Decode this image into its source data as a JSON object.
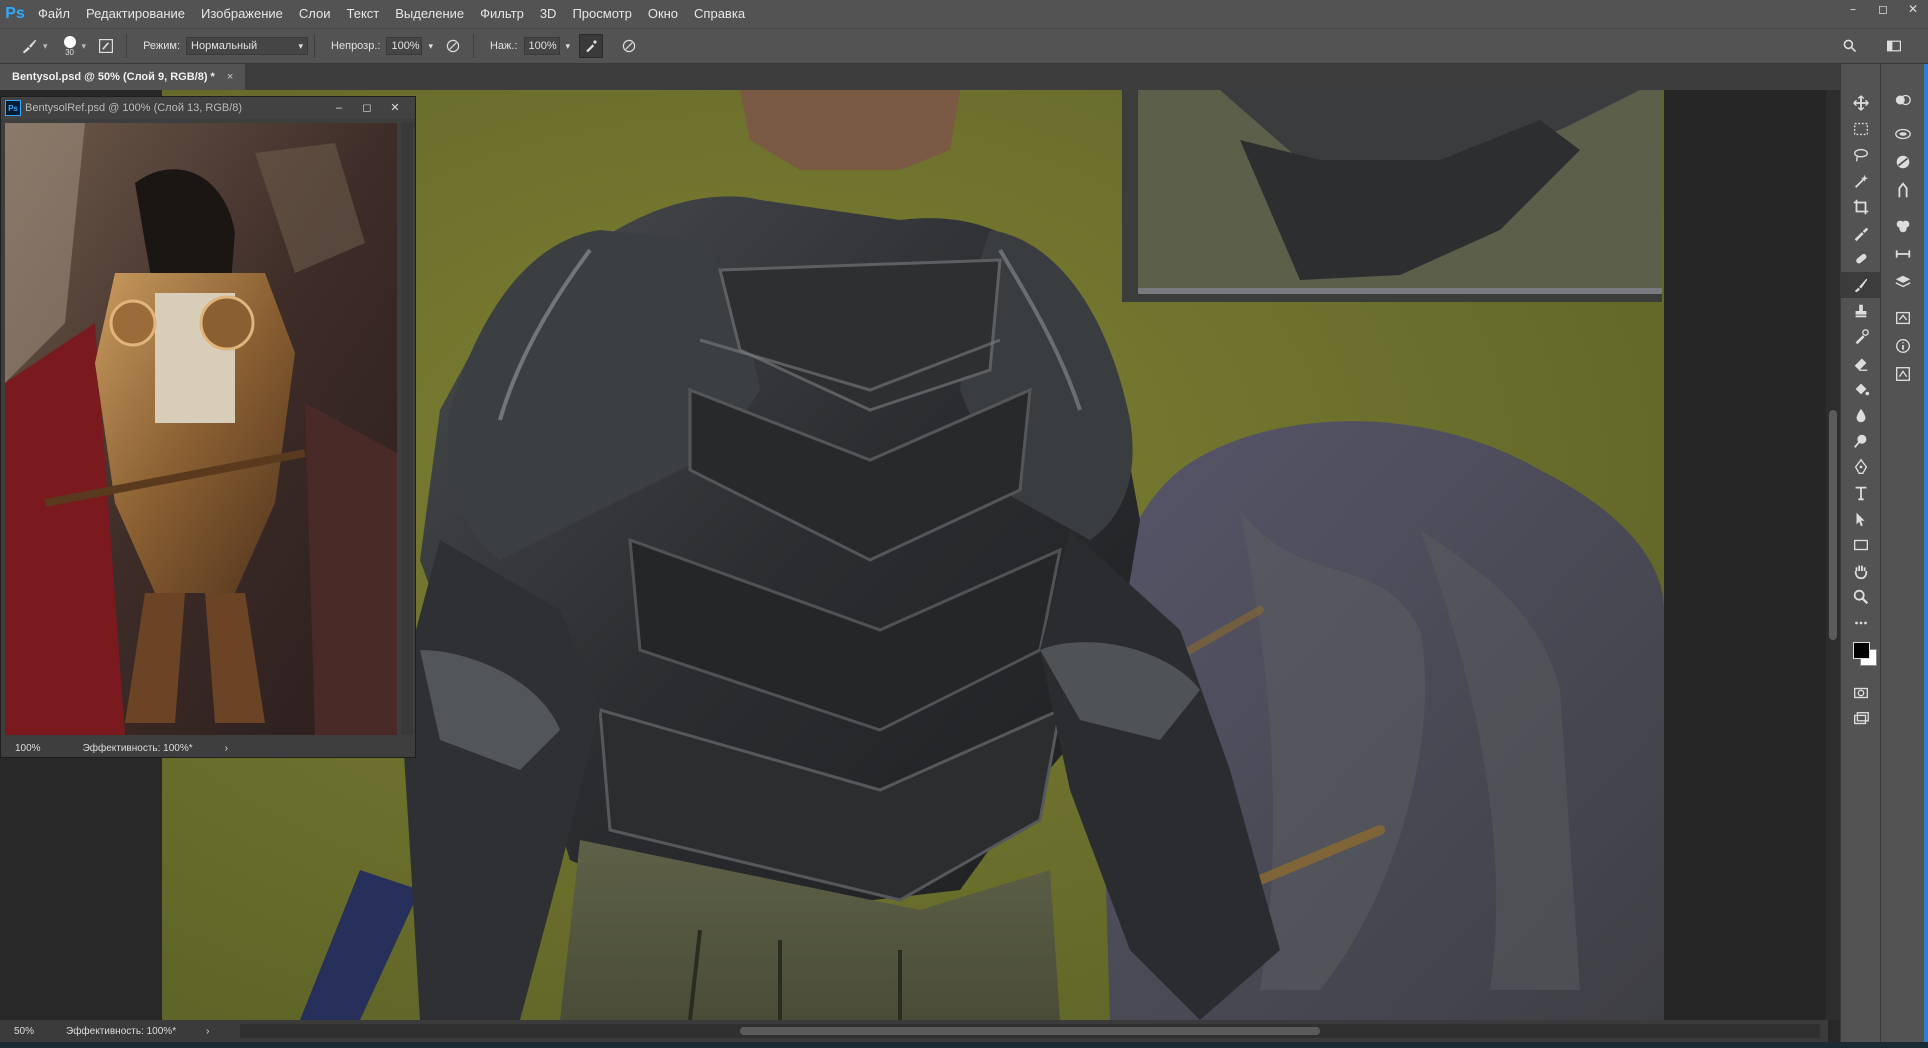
{
  "app": {
    "logo": "Ps"
  },
  "menu": [
    "Файл",
    "Редактирование",
    "Изображение",
    "Слои",
    "Текст",
    "Выделение",
    "Фильтр",
    "3D",
    "Просмотр",
    "Окно",
    "Справка"
  ],
  "window_controls": [
    "–",
    "◻",
    "✕"
  ],
  "options": {
    "brush_size": "30",
    "mode_label": "Режим:",
    "mode_value": "Нормальный",
    "opacity_label": "Непрозр.:",
    "opacity_value": "100%",
    "flow_label": "Наж.:",
    "flow_value": "100%"
  },
  "document": {
    "tab_title": "Bentysol.psd @ 50% (Слой 9, RGB/8) *",
    "tab_close": "×",
    "zoom": "50%",
    "status": "Эффективность: 100%*",
    "status_arrow": "›"
  },
  "reference_window": {
    "title": "BentysolRef.psd @ 100% (Слой 13, RGB/8)",
    "controls": [
      "–",
      "◻",
      "✕"
    ],
    "zoom": "100%",
    "status": "Эффективность: 100%*",
    "status_arrow": "›"
  },
  "tools": [
    "move-icon",
    "marquee-icon",
    "lasso-icon",
    "magic-wand-icon",
    "crop-icon",
    "eyedropper-icon",
    "healing-brush-icon",
    "brush-icon",
    "clone-stamp-icon",
    "history-brush-icon",
    "eraser-icon",
    "paint-bucket-icon",
    "blur-icon",
    "dodge-icon",
    "pen-icon",
    "type-icon",
    "path-selection-icon",
    "rectangle-icon",
    "hand-icon",
    "zoom-icon",
    "more-tools-icon"
  ],
  "panels": [
    "color-icon",
    "adjustments-icon",
    "libraries-icon",
    "styles-icon",
    "brush-settings-icon",
    "layers-icon",
    "channels-icon",
    "paths-icon",
    "properties-icon",
    "info-icon",
    "actions-icon"
  ],
  "colors": {
    "foreground": "#000000",
    "background": "#ffffff",
    "accent": "#31a8ff"
  }
}
